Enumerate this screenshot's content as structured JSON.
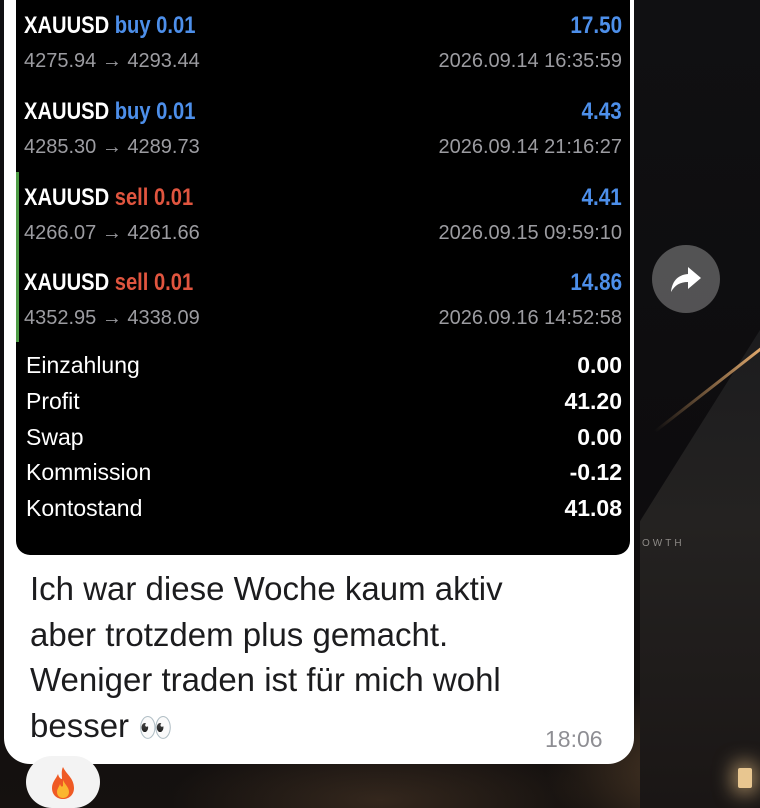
{
  "trades": [
    {
      "symbol": "XAUUSD",
      "direction": "buy 0.01",
      "type": "buy",
      "amount": "17.50",
      "prices": "4275.94 → 4293.44",
      "time": "2026.09.14 16:35:59"
    },
    {
      "symbol": "XAUUSD",
      "direction": "buy 0.01",
      "type": "buy",
      "amount": "4.43",
      "prices": "4285.30 → 4289.73",
      "time": "2026.09.14 21:16:27"
    },
    {
      "symbol": "XAUUSD",
      "direction": "sell 0.01",
      "type": "sell",
      "amount": "4.41",
      "prices": "4266.07 → 4261.66",
      "time": "2026.09.15 09:59:10"
    },
    {
      "symbol": "XAUUSD",
      "direction": "sell 0.01",
      "type": "sell",
      "amount": "14.86",
      "prices": "4352.95 → 4338.09",
      "time": "2026.09.16 14:52:58"
    }
  ],
  "summary": [
    {
      "label": "Einzahlung",
      "value": "0.00"
    },
    {
      "label": "Profit",
      "value": "41.20"
    },
    {
      "label": "Swap",
      "value": "0.00"
    },
    {
      "label": "Kommission",
      "value": "-0.12"
    },
    {
      "label": "Kontostand",
      "value": "41.08"
    }
  ],
  "message": {
    "line1": "Ich war diese Woche kaum aktiv",
    "line2": "aber trotzdem plus gemacht.",
    "line3": "Weniger traden ist für mich wohl",
    "line4": "besser",
    "emoji": "👀",
    "time": "18:06"
  },
  "reaction": {
    "emoji": "flame-icon"
  },
  "share": {
    "icon": "share-arrow-icon"
  },
  "background": {
    "text": "OWTH"
  },
  "colors": {
    "buy": "#4d8fea",
    "sell": "#e0553f",
    "amount": "#4d8fea",
    "sell_marker": "#4d9b45",
    "card_bg": "#000000",
    "bubble_bg": "#ffffff"
  }
}
